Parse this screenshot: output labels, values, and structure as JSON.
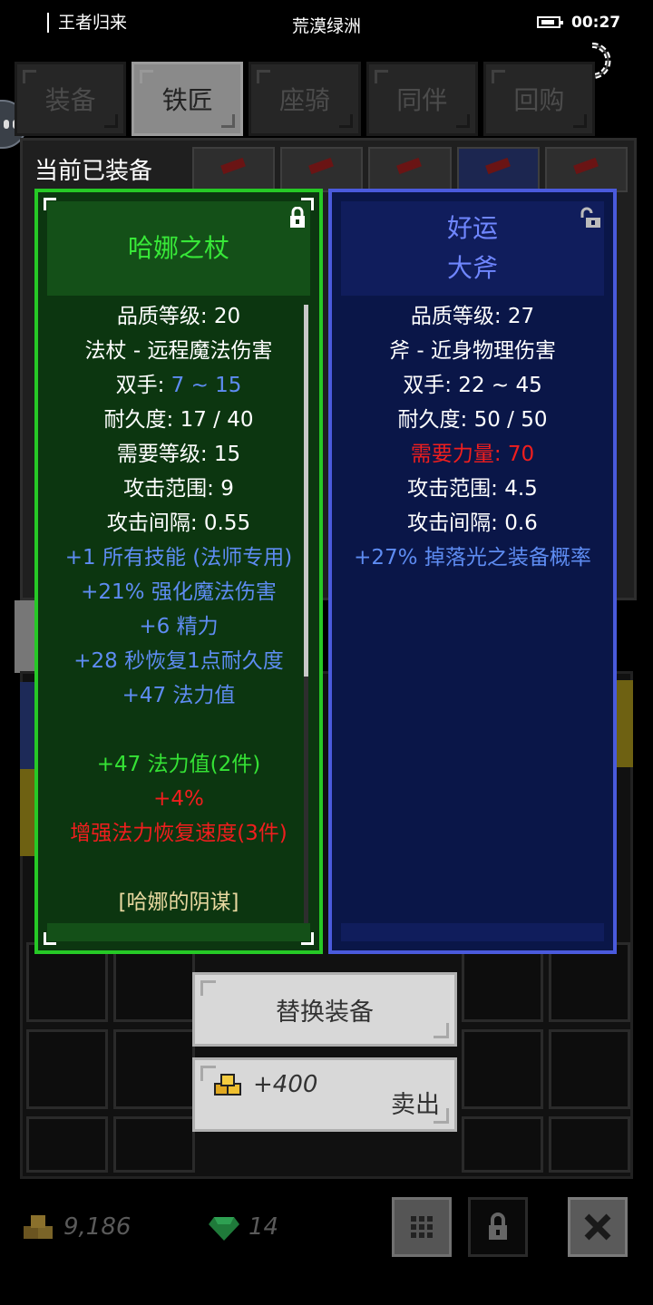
{
  "status_bar": {
    "character_name": "王者归来",
    "location": "荒漠绿洲",
    "time": "00:27"
  },
  "tabs": [
    {
      "label": "装备",
      "active": false
    },
    {
      "label": "铁匠",
      "active": true
    },
    {
      "label": "座骑",
      "active": false
    },
    {
      "label": "同伴",
      "active": false
    },
    {
      "label": "回购",
      "active": false
    }
  ],
  "equipped_title": "当前已装备",
  "equipped_item": {
    "name": "哈娜之杖",
    "rarity_color": "#38e838",
    "locked": true,
    "stats": {
      "quality": "品质等级: 20",
      "type": "法杖 - 远程魔法伤害",
      "damage_label": "双手: ",
      "damage_value": "7 ~ 15",
      "durability": "耐久度: 17 / 40",
      "req_level": "需要等级: 15",
      "range": "攻击范围: 9",
      "interval": "攻击间隔: 0.55"
    },
    "affixes": [
      "+1 所有技能 (法师专用)",
      "+21% 强化魔法伤害",
      "+6 精力",
      "+28 秒恢复1点耐久度",
      "+47 法力值"
    ],
    "set_bonuses": {
      "active": "+47 法力值(2件)",
      "inactive_1": "+4%",
      "inactive_2": "增强法力恢复速度(3件)"
    },
    "set_name": "[哈娜的阴谋]"
  },
  "compared_item": {
    "name_line1": "好运",
    "name_line2": "大斧",
    "rarity_color": "#6f86ff",
    "locked": false,
    "stats": {
      "quality": "品质等级: 27",
      "type": "斧 - 近身物理伤害",
      "damage": "双手: 22 ~ 45",
      "durability": "耐久度: 50 / 50",
      "req_strength": "需要力量: 70",
      "range": "攻击范围: 4.5",
      "interval": "攻击间隔: 0.6"
    },
    "affixes": [
      "+27% 掉落光之装备概率"
    ]
  },
  "actions": {
    "replace_label": "替换装备",
    "sell_price": "+400",
    "sell_label": "卖出"
  },
  "currency": {
    "gold": "9,186",
    "gems": "14"
  },
  "icons": {
    "refresh": "refresh-icon",
    "lock": "lock-icon",
    "unlock": "unlock-icon",
    "gold": "gold-coin-icon",
    "gem": "gem-icon",
    "grid": "grid-icon",
    "close": "close-icon"
  }
}
